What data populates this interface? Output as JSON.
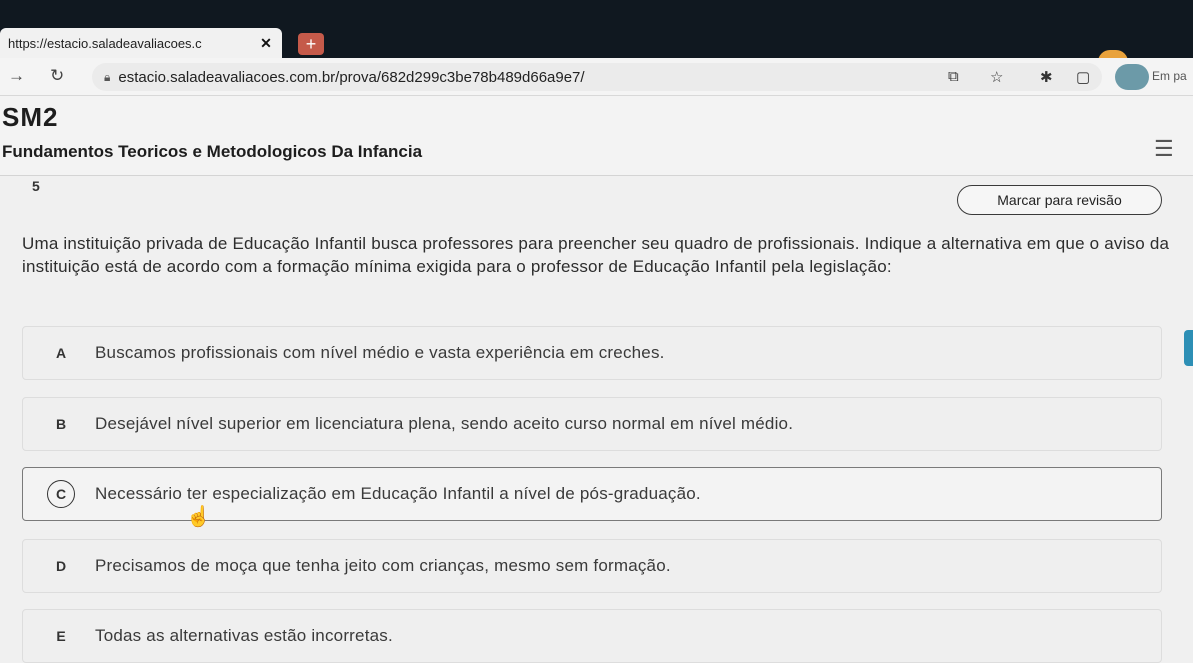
{
  "browser": {
    "tab_title": "https://estacio.saladeavaliacoes.c",
    "tab_close": "✕",
    "new_tab": "+",
    "url": "estacio.saladeavaliacoes.com.br/prova/682d299c3be78b489d66a9e7/",
    "profile_label": "Em pa"
  },
  "page": {
    "course_code": "SM2",
    "course_name": "Fundamentos Teoricos e Metodologicos Da Infancia"
  },
  "question": {
    "number": "5",
    "review_button": "Marcar para revisão",
    "text": "Uma instituição privada de Educação Infantil busca professores para preencher seu quadro de profissionais. Indique a alternativa em que o aviso da instituição está de acordo com a formação mínima exigida para o professor de Educação Infantil pela legislação:",
    "options": [
      {
        "letter": "A",
        "text": "Buscamos profissionais com nível médio e vasta experiência em creches."
      },
      {
        "letter": "B",
        "text": "Desejável nível superior em licenciatura plena, sendo aceito curso normal em nível médio."
      },
      {
        "letter": "C",
        "text": "Necessário ter especialização em Educação Infantil a nível de pós-graduação."
      },
      {
        "letter": "D",
        "text": "Precisamos de moça que tenha jeito com crianças, mesmo sem formação."
      },
      {
        "letter": "E",
        "text": "Todas as alternativas estão incorretas."
      }
    ]
  },
  "colors": {
    "accent": "#2d8fb5",
    "new_tab": "#c55a4a"
  }
}
